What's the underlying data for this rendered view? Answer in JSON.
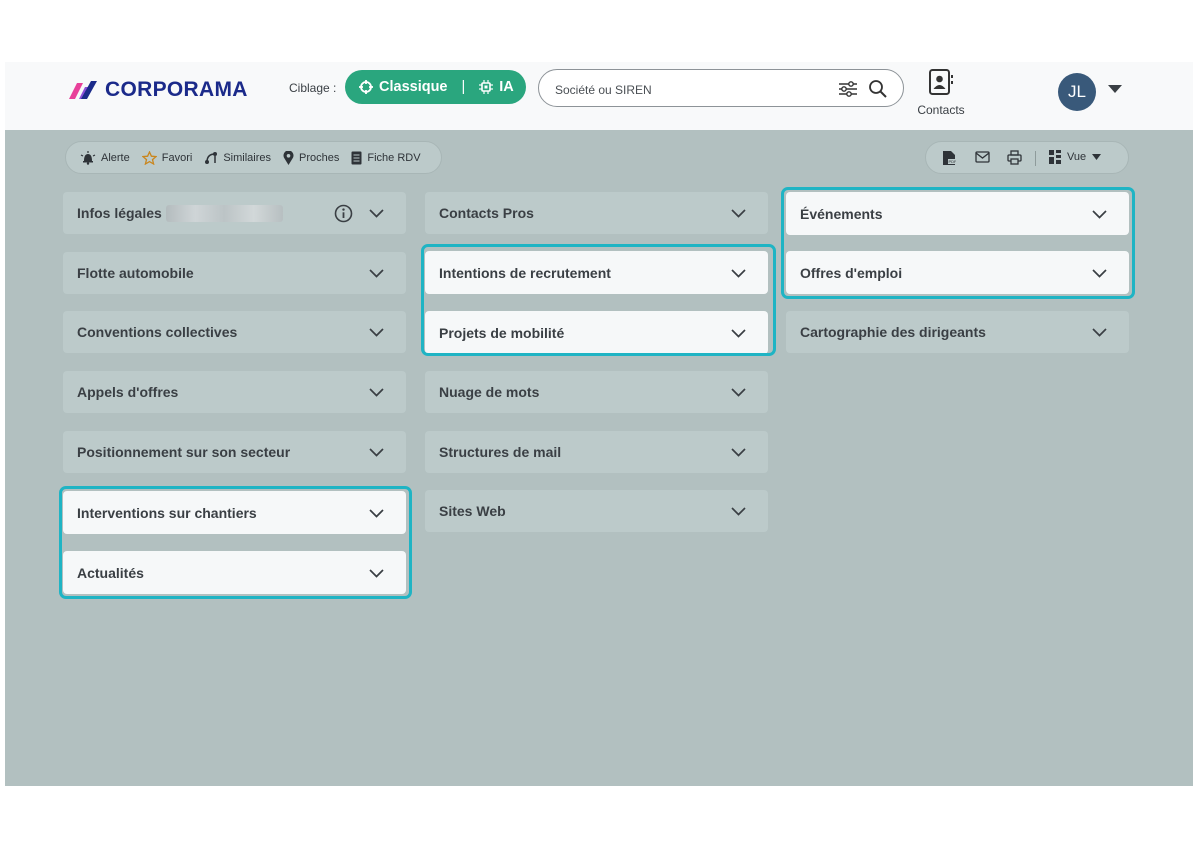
{
  "brand": {
    "name": "CORPORAMA"
  },
  "header": {
    "ciblage_label": "Ciblage :",
    "mode_classique": "Classique",
    "mode_ia": "IA",
    "search": {
      "placeholder": "Société ou SIREN",
      "value": ""
    },
    "contacts_label": "Contacts",
    "user_initials": "JL"
  },
  "toolbar": {
    "alerte": "Alerte",
    "favori": "Favori",
    "similaires": "Similaires",
    "proches": "Proches",
    "fiche_rdv": "Fiche RDV",
    "vue": "Vue"
  },
  "sections": {
    "col1": [
      "Infos légales",
      "Flotte automobile",
      "Conventions collectives",
      "Appels d'offres",
      "Positionnement sur son secteur",
      "Interventions sur chantiers",
      "Actualités"
    ],
    "col2": [
      "Contacts Pros",
      "Intentions de recrutement",
      "Projets de mobilité",
      "Nuage de mots",
      "Structures de mail",
      "Sites Web"
    ],
    "col3": [
      "Événements",
      "Offres d'emploi",
      "Cartographie des dirigeants"
    ]
  },
  "colors": {
    "brand_blue": "#1b2a8a",
    "classique_green": "#2aa67e",
    "highlight_teal": "#1fb4c4",
    "background_gray": "#b2c0c0",
    "avatar_blue": "#39597a"
  },
  "icons": [
    "logo-icon",
    "crosshair-icon",
    "chip-icon",
    "filter-icon",
    "search-icon",
    "contacts-icon",
    "caret-down-icon",
    "bell-icon",
    "star-icon",
    "similar-icon",
    "pin-icon",
    "document-icon",
    "pdf-icon",
    "mail-icon",
    "print-icon",
    "view-icon",
    "info-icon",
    "chevron-down-icon"
  ]
}
